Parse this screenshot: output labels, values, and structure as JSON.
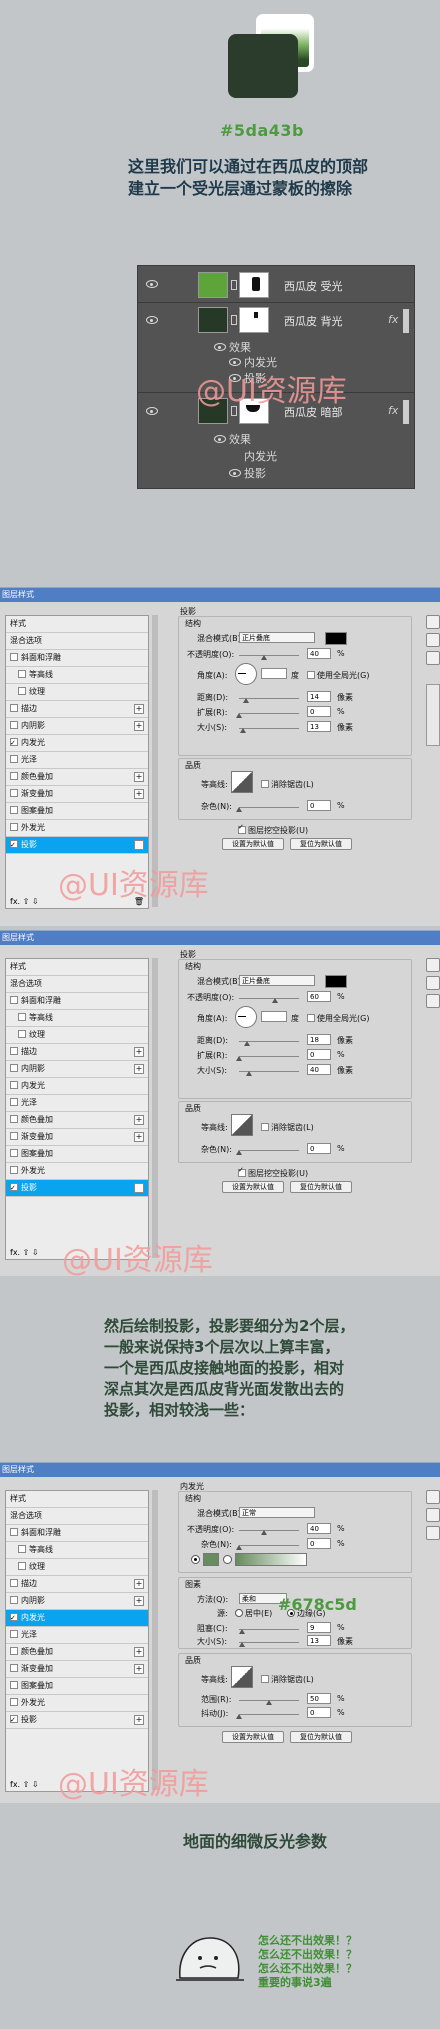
{
  "colors": {
    "swatch": "#5da43b",
    "wave_gradient": "#678c5d",
    "page_bg": "#c3c6c9"
  },
  "hex_label_1": "#5da43b",
  "caption_1": [
    "这里我们可以通过在西瓜皮的顶部",
    "建立一个受光层通过蒙板的擦除"
  ],
  "layers": {
    "rows": [
      {
        "name": "西瓜皮 受光"
      },
      {
        "name": "西瓜皮 背光",
        "fx": "fx",
        "effects_label": "效果",
        "effects": [
          "内发光",
          "投影"
        ]
      },
      {
        "name": "西瓜皮 暗部",
        "fx": "fx",
        "effects_label": "效果",
        "effects": [
          "内发光",
          "投影"
        ]
      }
    ]
  },
  "watermark": "@UI资源库",
  "dialog_title": "图层样式",
  "style_list": [
    {
      "label": "样式",
      "check": false
    },
    {
      "label": "混合选项",
      "check": false
    },
    {
      "label": "斜面和浮雕",
      "check": true
    },
    {
      "label": "等高线",
      "check": true
    },
    {
      "label": "纹理",
      "check": true
    },
    {
      "label": "描边",
      "check": true,
      "plus": true
    },
    {
      "label": "内阴影",
      "check": true,
      "plus": true
    },
    {
      "label": "内发光",
      "check": true
    },
    {
      "label": "光泽",
      "check": true
    },
    {
      "label": "颜色叠加",
      "check": true,
      "plus": true
    },
    {
      "label": "渐变叠加",
      "check": true,
      "plus": true
    },
    {
      "label": "图案叠加",
      "check": true
    },
    {
      "label": "外发光",
      "check": true
    },
    {
      "label": "投影",
      "check": true,
      "plus": true
    }
  ],
  "shadow": {
    "title": "投影",
    "structure": "结构",
    "blend_label": "混合模式(B):",
    "blend_value": "正片叠底",
    "opacity_label": "不透明度(O):",
    "angle_label": "角度(A):",
    "angle_unit": "度",
    "global_light": "使用全局光(G)",
    "distance_label": "距离(D):",
    "spread_label": "扩展(R):",
    "size_label": "大小(S):",
    "px": "像素",
    "pct": "%",
    "quality": "品质",
    "contour_label": "等高线:",
    "antialias": "消除锯齿(L)",
    "noise_label": "杂色(N):",
    "knockout": "图层挖空投影(U)",
    "set_default": "设置为默认值",
    "reset_default": "复位为默认值"
  },
  "dialog1": {
    "opacity": "40",
    "distance": "14",
    "spread": "0",
    "size": "13",
    "noise": "0"
  },
  "dialog2": {
    "opacity": "60",
    "distance": "18",
    "spread": "0",
    "size": "40",
    "noise": "0"
  },
  "caption_2": [
    "然后绘制投影，投影要细分为2个层，",
    "一般来说保持3个层次以上算丰富，",
    "一个是西瓜皮接触地面的投影，相对",
    "深点其次是西瓜皮背光面发散出去的",
    "投影，相对较浅一些："
  ],
  "inner_glow": {
    "title": "内发光",
    "structure": "结构",
    "blend_label": "混合模式(B):",
    "blend_value": "正常",
    "opacity_label": "不透明度(O):",
    "opacity": "40",
    "noise_label": "杂色(N):",
    "noise": "0",
    "elements": "图素",
    "method_label": "方法(Q):",
    "method_value": "柔和",
    "source_label": "源:",
    "center": "居中(E)",
    "edge": "边缘(G)",
    "choke_label": "阻塞(C):",
    "choke": "9",
    "size_label": "大小(S):",
    "size": "13",
    "quality": "品质",
    "contour_label": "等高线:",
    "antialias": "消除锯齿(L)",
    "range_label": "范围(R):",
    "range": "50",
    "jitter_label": "抖动(J):",
    "jitter": "0"
  },
  "hex_label_2": "#678c5d",
  "caption_3": "地面的细微反光参数",
  "bottom_text": [
    "怎么还不出效果！？",
    "怎么还不出效果！？",
    "怎么还不出效果！？",
    "重要的事说3遍"
  ]
}
